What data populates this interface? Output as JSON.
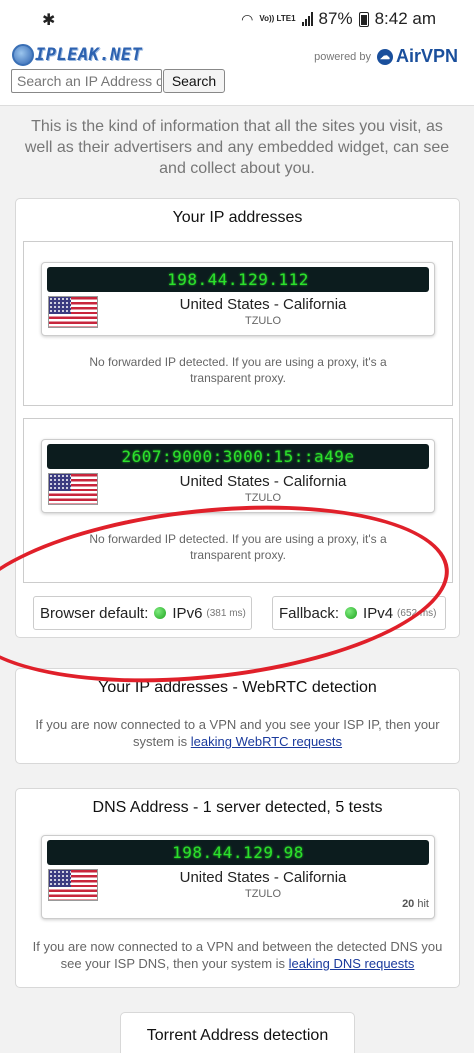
{
  "status_bar": {
    "time": "8:42 am",
    "battery": "87%",
    "network": "Vo)) LTE1"
  },
  "header": {
    "logo_text": "IPLEAK.NET",
    "powered_by": "powered by",
    "brand": "AirVPN",
    "search_placeholder": "Search an IP Address o",
    "search_button": "Search"
  },
  "intro": "This is the kind of information that all the sites you visit, as well as their advertisers and any embedded widget, can see and collect about you.",
  "ip_addresses": {
    "title": "Your IP addresses",
    "entries": [
      {
        "ip": "198.44.129.112",
        "location": "United States - California",
        "isp": "TZULO",
        "note": "No forwarded IP detected. If you are using a proxy, it's a transparent proxy."
      },
      {
        "ip": "2607:9000:3000:15::a49e",
        "location": "United States - California",
        "isp": "TZULO",
        "note": "No forwarded IP detected. If you are using a proxy, it's a transparent proxy."
      }
    ],
    "browser_default_label": "Browser default:",
    "browser_default_value": "IPv6",
    "browser_default_ms": "(381 ms)",
    "fallback_label": "Fallback:",
    "fallback_value": "IPv4",
    "fallback_ms": "(652 ms)"
  },
  "webrtc": {
    "title": "Your IP addresses - WebRTC detection",
    "text_before": "If you are now connected to a VPN and you see your ISP IP, then your system is ",
    "link": "leaking WebRTC requests"
  },
  "dns": {
    "title": "DNS Address - 1 server detected, 5 tests",
    "ip": "198.44.129.98",
    "location": "United States - California",
    "isp": "TZULO",
    "hits": "20",
    "hits_label": "hit",
    "text_before": "If you are now connected to a VPN and between the detected DNS you see your ISP DNS, then your system is ",
    "link": "leaking DNS requests"
  },
  "torrent": {
    "title": "Torrent Address detection"
  },
  "colors": {
    "ip_text": "#2ce02c",
    "ip_bar_bg": "#0c1c1e",
    "annotation": "#e0202a",
    "link": "#1a3a9c"
  }
}
